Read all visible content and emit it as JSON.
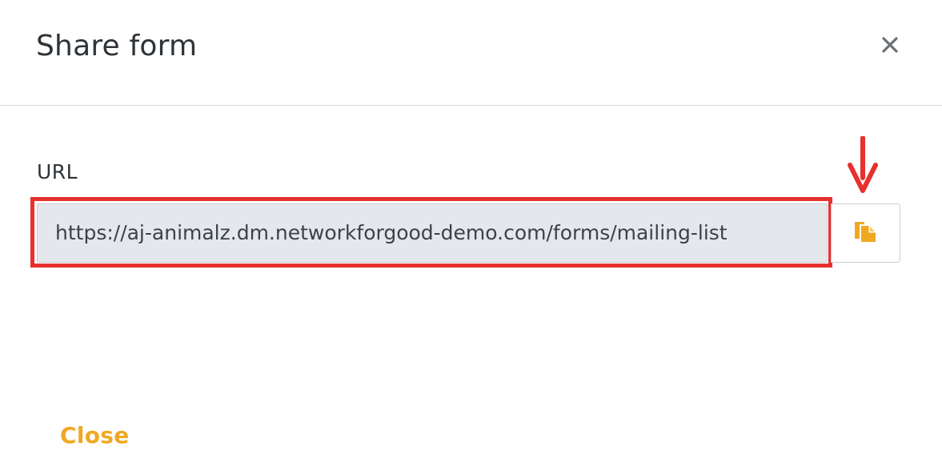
{
  "dialog": {
    "title": "Share form",
    "close_icon": "close-icon"
  },
  "url_field": {
    "label": "URL",
    "value": "https://aj-animalz.dm.networkforgood-demo.com/forms/mailing-list",
    "copy_icon": "copy-icon"
  },
  "annotation": {
    "arrow_icon": "arrow-down-icon",
    "highlight_color": "#e8302e"
  },
  "footer": {
    "close_label": "Close"
  },
  "colors": {
    "accent": "#f0a823",
    "title_text": "#2e3338",
    "input_bg": "#e4e8ec"
  }
}
